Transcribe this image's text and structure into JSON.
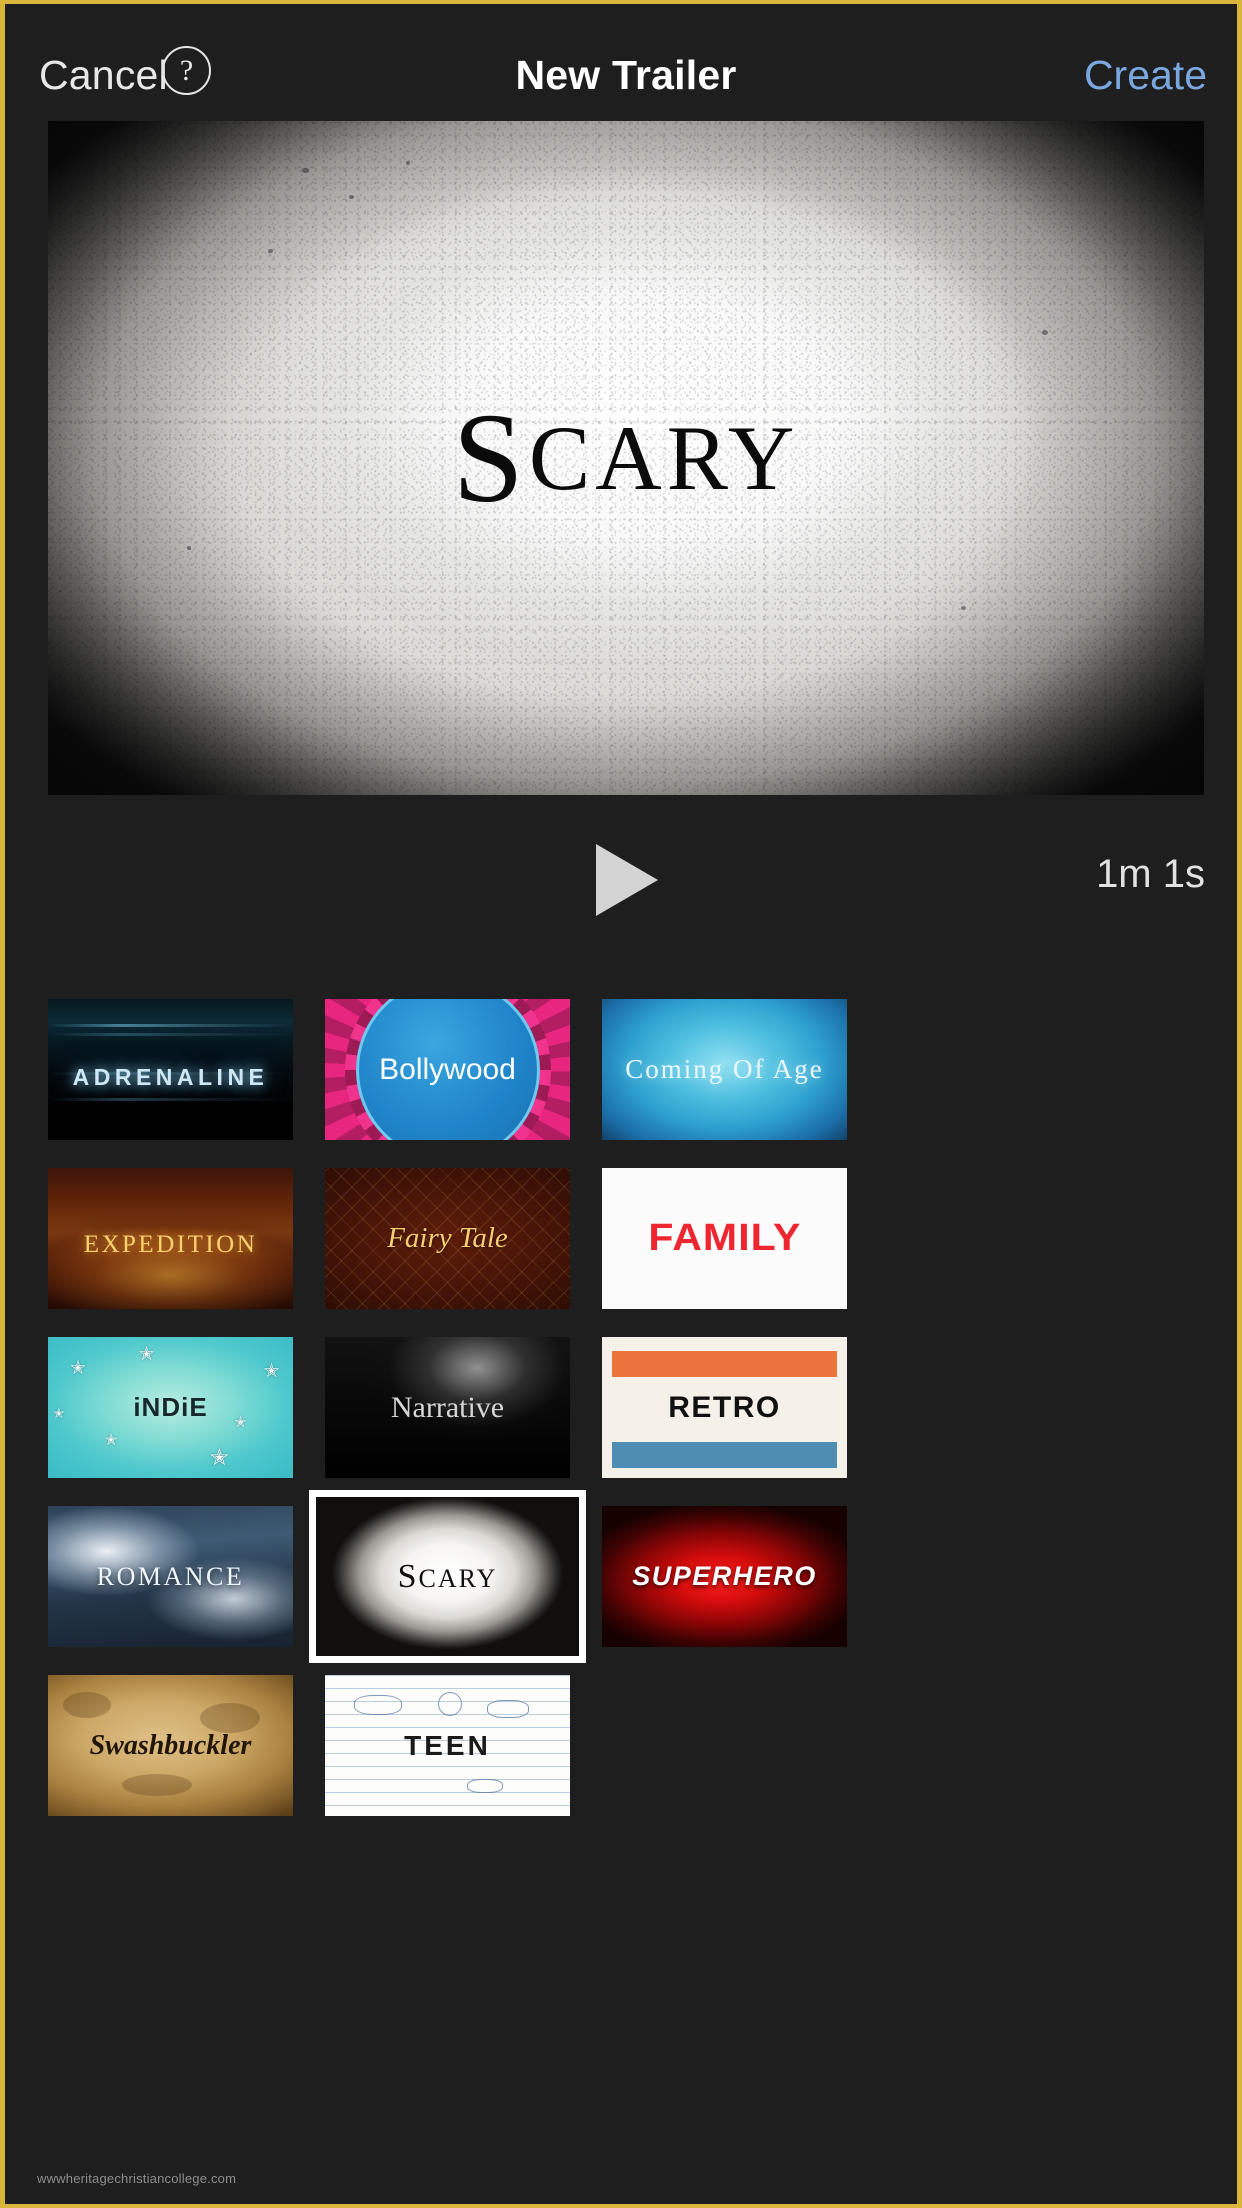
{
  "navbar": {
    "cancel_label": "Cancel",
    "help_label": "?",
    "title": "New Trailer",
    "create_label": "Create"
  },
  "preview": {
    "theme_name": "Scary",
    "title_first_letter": "S",
    "title_rest": "CARY"
  },
  "player": {
    "play_label": "",
    "duration": "1m 1s"
  },
  "themes": [
    {
      "id": "adrenaline",
      "label": "ADRENALINE",
      "selected": false,
      "colors": {
        "background": "#0b2b38",
        "text": "#cfe8f5"
      }
    },
    {
      "id": "bollywood",
      "label": "Bollywood",
      "selected": false,
      "colors": {
        "background": "#1f84c9",
        "text": "#ffffff",
        "accent": "#e8267f"
      }
    },
    {
      "id": "coming-of-age",
      "label": "Coming Of Age",
      "selected": false,
      "colors": {
        "background": "#4fc0e0",
        "text": "#eaf8ff"
      }
    },
    {
      "id": "expedition",
      "label": "EXPEDITION",
      "selected": false,
      "colors": {
        "background": "#5e2409",
        "text": "#fcd270"
      }
    },
    {
      "id": "fairy-tale",
      "label": "Fairy Tale",
      "selected": false,
      "colors": {
        "background": "#431307",
        "text": "#f7cd72"
      }
    },
    {
      "id": "family",
      "label": "FAMILY",
      "selected": false,
      "colors": {
        "background": "#fbfbfb",
        "text": "#ed2630"
      }
    },
    {
      "id": "indie",
      "label": "iNDiE",
      "selected": false,
      "colors": {
        "background": "#4ec9cd",
        "text": "#17272b"
      }
    },
    {
      "id": "narrative",
      "label": "Narrative",
      "selected": false,
      "colors": {
        "background": "#090909",
        "text": "#d6d6d6"
      }
    },
    {
      "id": "retro",
      "label": "RETRO",
      "selected": false,
      "colors": {
        "background": "#f5f1e8",
        "text": "#111111",
        "accent": "#e8682f",
        "accent2": "#3f85ad"
      }
    },
    {
      "id": "romance",
      "label": "ROMANCE",
      "selected": false,
      "colors": {
        "background": "#3e5a74",
        "text": "#eef6ff"
      }
    },
    {
      "id": "scary",
      "label": "Scary",
      "label_first": "S",
      "label_rest": "CARY",
      "selected": true,
      "colors": {
        "background": "#f6f5f3",
        "text": "#111111"
      }
    },
    {
      "id": "superhero",
      "label": "SUPERHERO",
      "selected": false,
      "colors": {
        "background": "#d00b0b",
        "text": "#ffffff"
      }
    },
    {
      "id": "swashbuckler",
      "label": "Swashbuckler",
      "selected": false,
      "colors": {
        "background": "#cda968",
        "text": "#211506"
      }
    },
    {
      "id": "teen",
      "label": "TEEN",
      "selected": false,
      "colors": {
        "background": "#fcfcfa",
        "text": "#1a1a1a"
      }
    }
  ],
  "footer": {
    "watermark": "wwwheritagechristiancollege.com"
  },
  "colors": {
    "app_background": "#1e1e1e",
    "nav_text": "#e8e8e8",
    "accent_blue": "#7aa7e0",
    "selection_border": "#ffffff",
    "frame": "#d8b63a"
  }
}
